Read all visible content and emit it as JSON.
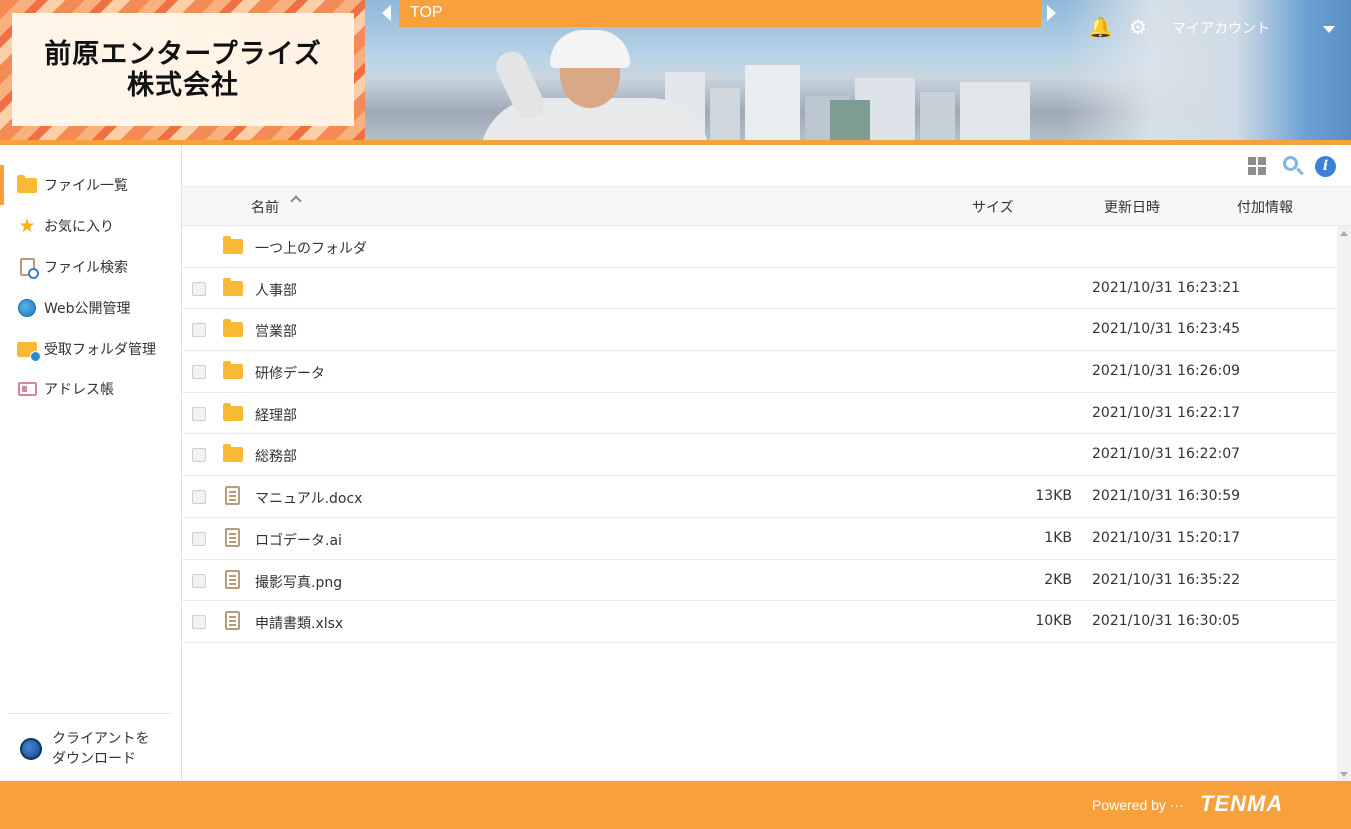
{
  "header": {
    "logo_line1": "前原エンタープライズ",
    "logo_line2": "株式会社",
    "breadcrumb": "TOP",
    "account_label": "マイアカウント",
    "accent_color": "#f8a03c"
  },
  "sidebar": {
    "items": [
      {
        "label": "ファイル一覧",
        "icon": "folder-icon"
      },
      {
        "label": "お気に入り",
        "icon": "star-icon"
      },
      {
        "label": "ファイル検索",
        "icon": "file-search-icon"
      },
      {
        "label": "Web公開管理",
        "icon": "globe-icon"
      },
      {
        "label": "受取フォルダ管理",
        "icon": "folder-globe-icon"
      },
      {
        "label": "アドレス帳",
        "icon": "address-card-icon"
      }
    ],
    "client_download_line1": "クライアントを",
    "client_download_line2": "ダウンロード"
  },
  "table": {
    "headers": {
      "name": "名前",
      "size": "サイズ",
      "date": "更新日時",
      "extra": "付加情報"
    },
    "parent_folder": "一つ上のフォルダ",
    "rows": [
      {
        "type": "folder",
        "name": "人事部",
        "size": "",
        "date": "2021/10/31 16:23:21"
      },
      {
        "type": "folder",
        "name": "営業部",
        "size": "",
        "date": "2021/10/31 16:23:45"
      },
      {
        "type": "folder",
        "name": "研修データ",
        "size": "",
        "date": "2021/10/31 16:26:09"
      },
      {
        "type": "folder",
        "name": "経理部",
        "size": "",
        "date": "2021/10/31 16:22:17"
      },
      {
        "type": "folder",
        "name": "総務部",
        "size": "",
        "date": "2021/10/31 16:22:07"
      },
      {
        "type": "file",
        "name": "マニュアル.docx",
        "size": "13KB",
        "date": "2021/10/31 16:30:59"
      },
      {
        "type": "file",
        "name": "ロゴデータ.ai",
        "size": "1KB",
        "date": "2021/10/31 15:20:17"
      },
      {
        "type": "file",
        "name": "撮影写真.png",
        "size": "2KB",
        "date": "2021/10/31 16:35:22"
      },
      {
        "type": "file",
        "name": "申請書類.xlsx",
        "size": "10KB",
        "date": "2021/10/31 16:30:05"
      }
    ]
  },
  "footer": {
    "powered_by": "Powered by ···",
    "brand": "TENMA"
  }
}
